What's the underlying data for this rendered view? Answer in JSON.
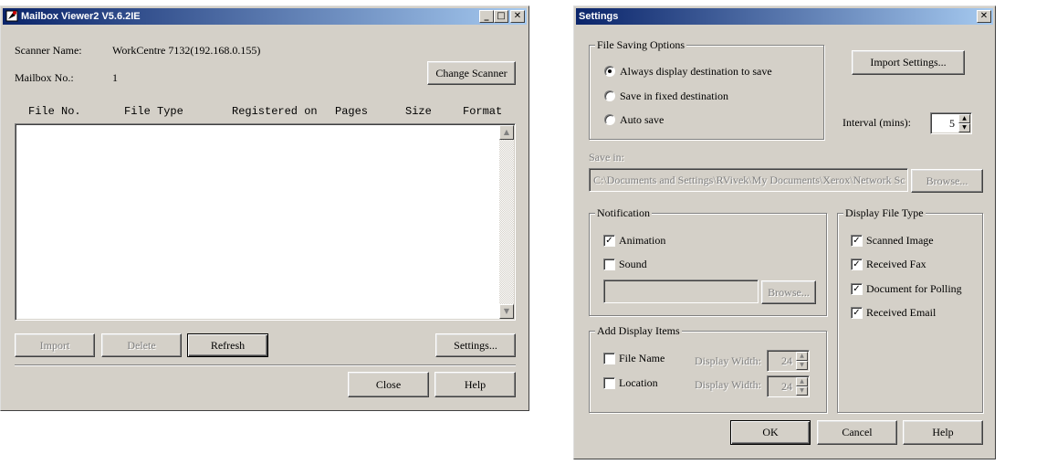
{
  "mailbox": {
    "title": "Mailbox Viewer2 V5.6.2IE",
    "scanner_label": "Scanner Name:",
    "scanner_value": "WorkCentre 7132(192.168.0.155)",
    "mailbox_label": "Mailbox No.:",
    "mailbox_value": "1",
    "change_scanner": "Change Scanner",
    "columns": [
      "File No.",
      "File Type",
      "Registered on",
      "Pages",
      "Size",
      "Format"
    ],
    "buttons": {
      "import": "Import",
      "delete": "Delete",
      "refresh": "Refresh",
      "settings": "Settings...",
      "close": "Close",
      "help": "Help"
    }
  },
  "settings": {
    "title": "Settings",
    "file_saving": {
      "legend": "File Saving Options",
      "options": [
        "Always display destination to save",
        "Save in fixed destination",
        "Auto save"
      ],
      "selected": "Always display destination to save"
    },
    "import_settings": "Import Settings...",
    "interval_label": "Interval (mins):",
    "interval_value": "5",
    "save_in_label": "Save in:",
    "save_in_value": "C:\\Documents and Settings\\RVivek\\My Documents\\Xerox\\Network Sc",
    "browse": "Browse...",
    "notification": {
      "legend": "Notification",
      "animation": "Animation",
      "animation_checked": true,
      "sound": "Sound",
      "sound_checked": false,
      "browse": "Browse..."
    },
    "display_file_type": {
      "legend": "Display File Type",
      "items": [
        {
          "label": "Scanned Image",
          "checked": true
        },
        {
          "label": "Received Fax",
          "checked": true
        },
        {
          "label": "Document for Polling",
          "checked": true
        },
        {
          "label": "Received Email",
          "checked": true
        }
      ]
    },
    "add_display": {
      "legend": "Add Display Items",
      "file_name": "File Name",
      "location": "Location",
      "width_label": "Display Width:",
      "file_name_width": "24",
      "location_width": "24"
    },
    "buttons": {
      "ok": "OK",
      "cancel": "Cancel",
      "help": "Help"
    }
  },
  "icons": {
    "close": "close-icon",
    "minimize": "minimize-icon",
    "maximize": "maximize-icon"
  }
}
